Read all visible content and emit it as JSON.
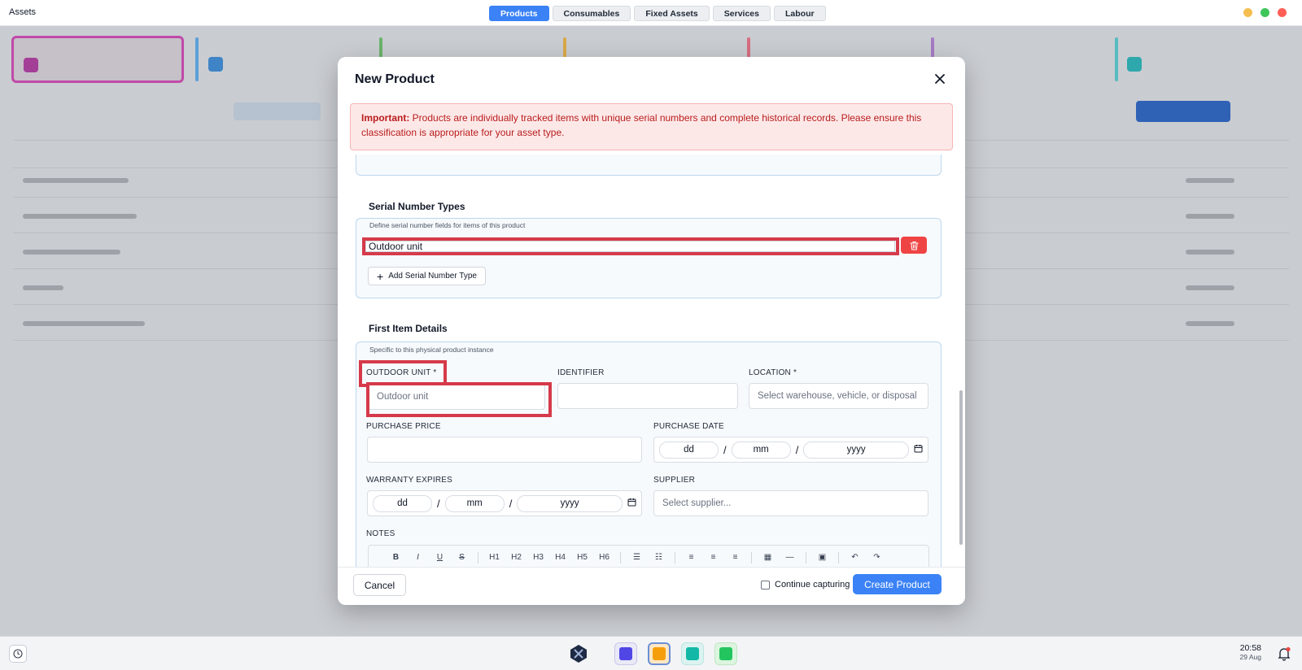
{
  "app": {
    "title": "Assets"
  },
  "tabs": [
    {
      "label": "Products",
      "active": true
    },
    {
      "label": "Consumables",
      "active": false
    },
    {
      "label": "Fixed Assets",
      "active": false
    },
    {
      "label": "Services",
      "active": false
    },
    {
      "label": "Labour",
      "active": false
    }
  ],
  "window_controls": {
    "colors": [
      "#f5bf4f",
      "#3ec55a",
      "#ff5f57"
    ]
  },
  "modal": {
    "title": "New Product",
    "close_icon": "close-icon",
    "alert": {
      "bold": "Important:",
      "text": "Products are individually tracked items with unique serial numbers and complete historical records. Please ensure this classification is appropriate for your asset type."
    },
    "serial_section": {
      "title": "Serial Number Types",
      "subtitle": "Define serial number fields for items of this product",
      "serial_value": "Outdoor unit",
      "add_label": "Add Serial Number Type"
    },
    "first_item": {
      "title": "First Item Details",
      "subtitle": "Specific to this physical product instance",
      "outdoor_unit_label": "OUTDOOR UNIT *",
      "outdoor_unit_placeholder": "Outdoor unit",
      "identifier_label": "IDENTIFIER",
      "location_label": "LOCATION *",
      "location_placeholder": "Select warehouse, vehicle, or disposal",
      "purchase_price_label": "PURCHASE PRICE",
      "purchase_date_label": "PURCHASE DATE",
      "warranty_label": "WARRANTY EXPIRES",
      "supplier_label": "SUPPLIER",
      "supplier_placeholder": "Select supplier...",
      "notes_label": "NOTES",
      "date_parts": {
        "dd": "dd",
        "mm": "mm",
        "yyyy": "yyyy",
        "sep": "/"
      },
      "toolbar": [
        "B",
        "I",
        "U",
        "S",
        "H1",
        "H2",
        "H3",
        "H4",
        "H5",
        "H6"
      ]
    },
    "footer": {
      "cancel": "Cancel",
      "continue_label": "Continue capturing",
      "continue_checked": false,
      "create": "Create Product"
    }
  },
  "taskbar": {
    "time": "20:58",
    "date": "29 Aug"
  },
  "colors": {
    "accent": "#3b82f6",
    "danger": "#ef4444",
    "highlight": "#d63a4a"
  }
}
